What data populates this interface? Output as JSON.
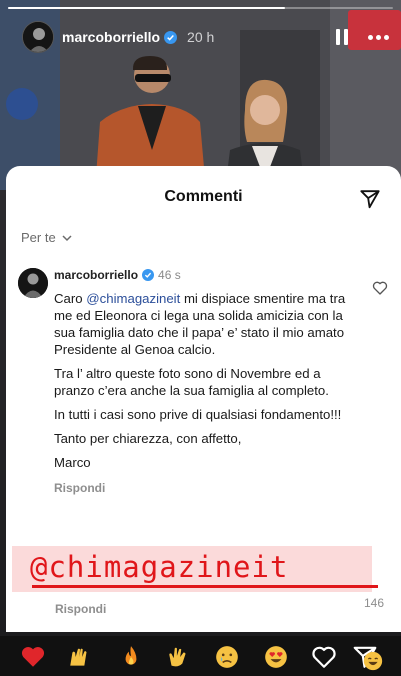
{
  "story": {
    "progress": 0.72,
    "username": "marcoborriello",
    "time": "20 h"
  },
  "sheet": {
    "title": "Commenti",
    "filter_label": "Per te"
  },
  "comment": {
    "username": "marcoborriello",
    "time": "46 s",
    "mention": "@chimagazineit",
    "p1_before": "Caro ",
    "p1_after": " mi dispiace smentire ma tra me ed Eleonora ci lega una solida amicizia con la sua famiglia dato che il papa’ e’ stato il mio amato Presidente al Genoa calcio.",
    "p2": "Tra l’ altro queste foto sono di Novembre ed a pranzo c’era anche la sua famiglia al completo.",
    "p3": "In tutti i casi sono prive di qualsiasi fondamento!!!",
    "p4": "Tanto per chiarezza, con affetto,",
    "p5": "Marco",
    "reply_label": "Rispondi"
  },
  "banner": {
    "text": "@chimagazineit"
  },
  "footer": {
    "reply_label": "Rispondi",
    "likes_count": "146"
  },
  "reactions": [
    "red-heart",
    "raising-hands",
    "fire",
    "clapping-hands",
    "crying-face",
    "heart-eyes",
    "laughing-tears"
  ],
  "colors": {
    "mention": "#2c4f9a",
    "banner_bg": "#fbdada",
    "banner_text": "#e0161a",
    "verified": "#3897f0"
  }
}
